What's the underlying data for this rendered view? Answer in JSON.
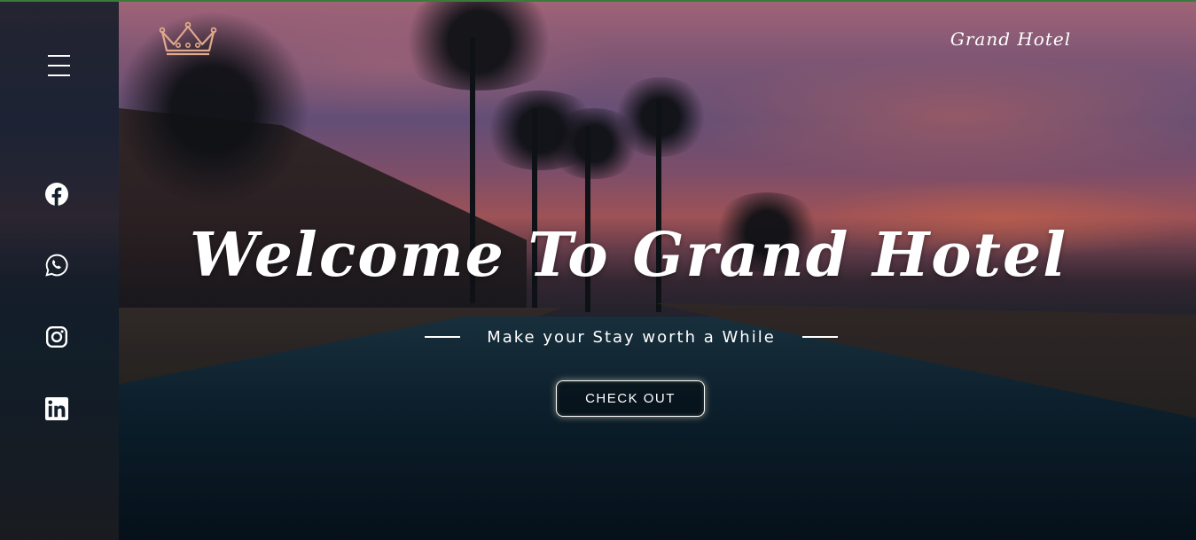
{
  "header": {
    "brand_name": "Grand Hotel",
    "logo_icon": "crown-icon",
    "logo_color": "#e0a98c"
  },
  "sidebar": {
    "menu_icon": "hamburger-menu-icon",
    "socials": [
      {
        "name": "facebook",
        "icon": "facebook-icon"
      },
      {
        "name": "whatsapp",
        "icon": "whatsapp-icon"
      },
      {
        "name": "instagram",
        "icon": "instagram-icon"
      },
      {
        "name": "linkedin",
        "icon": "linkedin-icon"
      }
    ]
  },
  "hero": {
    "title": "Welcome To Grand Hotel",
    "tagline": "Make your Stay worth a While",
    "cta_label": "CHECK OUT"
  },
  "colors": {
    "accent_line": "#3a7a3a",
    "text": "#ffffff"
  }
}
